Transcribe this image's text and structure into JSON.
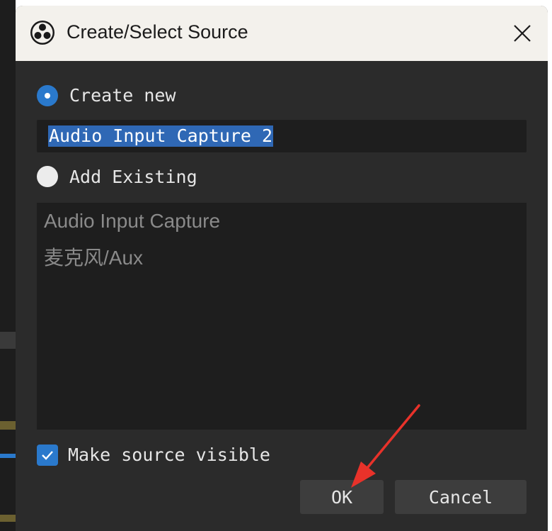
{
  "dialog": {
    "title": "Create/Select Source",
    "create_new_label": "Create new",
    "source_name_value": "Audio Input Capture 2",
    "add_existing_label": "Add Existing",
    "existing_sources": [
      "Audio Input Capture",
      "麦克风/Aux"
    ],
    "make_visible_label": "Make source visible",
    "ok_label": "OK",
    "cancel_label": "Cancel"
  },
  "colors": {
    "accent": "#2a79cc",
    "titlebar": "#f3f1ec",
    "dialog_bg": "#2b2b2b",
    "annotation_arrow": "#e8322a"
  },
  "icons": {
    "app": "obs-logo-icon",
    "close": "close-icon",
    "check": "checkmark-icon"
  }
}
